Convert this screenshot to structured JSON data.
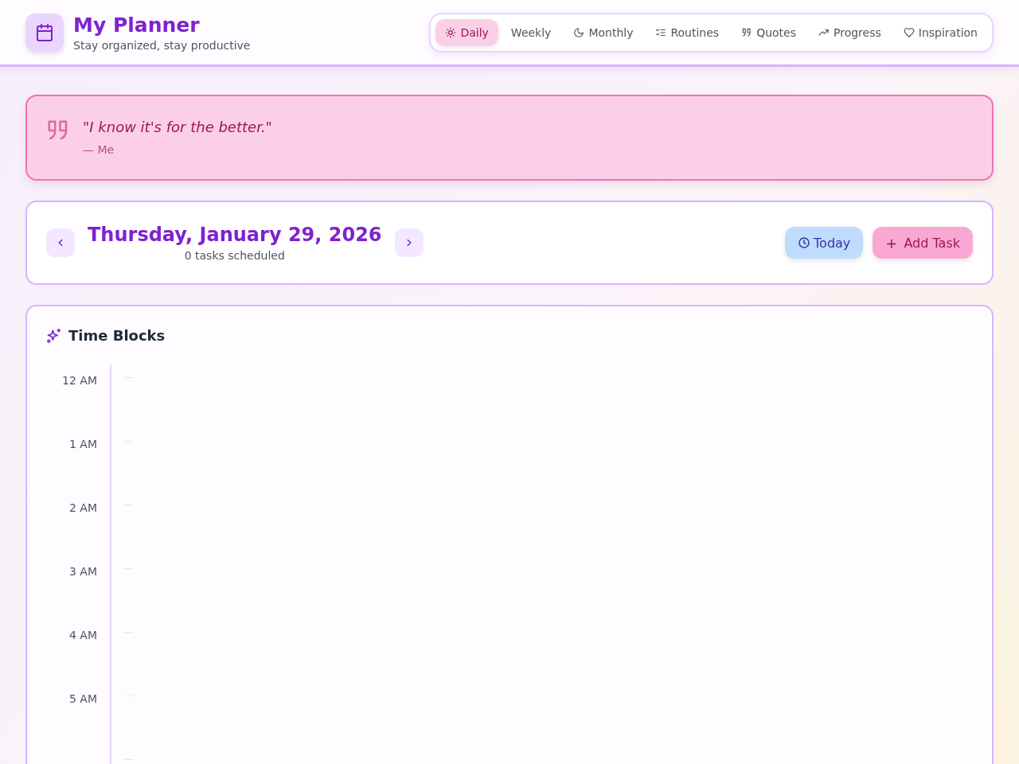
{
  "app": {
    "title": "My Planner",
    "subtitle": "Stay organized, stay productive"
  },
  "tabs": [
    {
      "label": "Daily",
      "kind": "sun",
      "selected": true
    },
    {
      "label": "Weekly",
      "kind": "plain",
      "selected": false
    },
    {
      "label": "Monthly",
      "kind": "moon",
      "selected": false
    },
    {
      "label": "Routines",
      "kind": "checklist",
      "selected": false
    },
    {
      "label": "Quotes",
      "kind": "quote",
      "selected": false
    },
    {
      "label": "Progress",
      "kind": "trend",
      "selected": false
    },
    {
      "label": "Inspiration",
      "kind": "heart",
      "selected": false
    }
  ],
  "quote": {
    "text": "\"I know it's for the better.\"",
    "author": "— Me"
  },
  "day": {
    "date": "Thursday, January 29, 2026",
    "summary": "0 tasks scheduled",
    "buttons": [
      "Today",
      "Add Task"
    ],
    "add_symbol": "+"
  },
  "time_blocks": {
    "title": "Time Blocks",
    "hours": [
      "12 AM",
      "1 AM",
      "2 AM",
      "3 AM",
      "4 AM",
      "5 AM"
    ]
  }
}
